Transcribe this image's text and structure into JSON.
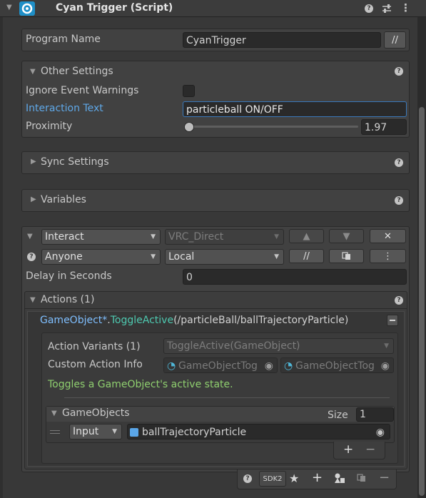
{
  "header": {
    "title": "Cyan Trigger (Script)"
  },
  "program": {
    "label": "Program Name",
    "value": "CyanTrigger",
    "button": "//"
  },
  "other_settings": {
    "title": "Other Settings",
    "ignore_warnings_label": "Ignore Event Warnings",
    "ignore_warnings_checked": false,
    "interaction_label": "Interaction Text",
    "interaction_value": "particleball ON/OFF",
    "proximity_label": "Proximity",
    "proximity_value": "1.97",
    "proximity_fraction": 0.02
  },
  "sync_settings": {
    "title": "Sync Settings"
  },
  "variables": {
    "title": "Variables"
  },
  "event": {
    "type": "Interact",
    "broadcast": "VRC_Direct",
    "user_gate": "Anyone",
    "network": "Local",
    "up_label": "▲",
    "down_label": "▼",
    "close_label": "✕",
    "comment_label": "//",
    "more_label": "⋮",
    "delay_label": "Delay in Seconds",
    "delay_value": "0"
  },
  "actions": {
    "title": "Actions (1)",
    "method": {
      "object": "GameObject*",
      "dot": ".",
      "name": "ToggleActive",
      "args": "(/particleBall/ballTrajectoryParticle)"
    },
    "variants_label": "Action Variants (1)",
    "variants_value": "ToggleActive(GameObject)",
    "custom_info_label": "Custom Action Info",
    "custom_info_values": [
      "GameObjectTog",
      "GameObjectTog"
    ],
    "description": "Toggles a GameObject's active state.",
    "gameobjects": {
      "title": "GameObjects",
      "size_label": "Size",
      "size_value": "1",
      "row": {
        "mode": "Input",
        "value": "ballTrajectoryParticle"
      },
      "add_label": "+",
      "remove_label": "−"
    }
  },
  "footer": {
    "sdk_label": "SDK2",
    "add_label": "+",
    "remove_label": "−"
  },
  "colors": {
    "link": "#5fa8e8",
    "method": "#7fbfff",
    "func": "#4ec9b0",
    "desc": "#8fcf6f",
    "accent": "#3a79bb"
  }
}
